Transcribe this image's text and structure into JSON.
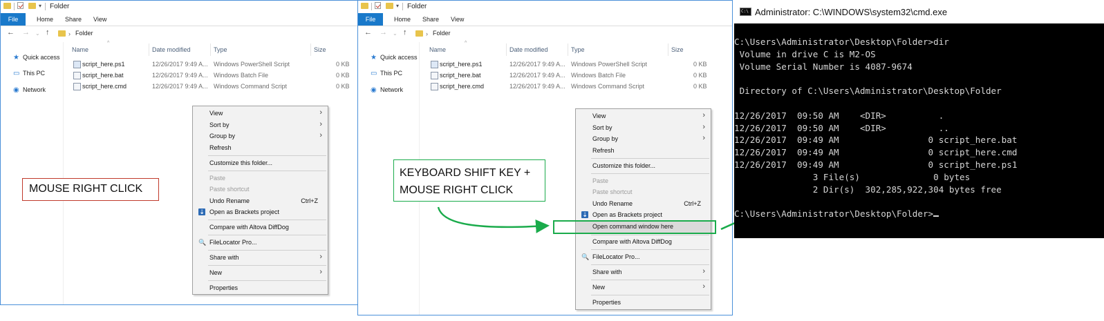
{
  "explorer": {
    "title": "Folder",
    "tabs": {
      "file": "File",
      "home": "Home",
      "share": "Share",
      "view": "View"
    },
    "address": "Folder",
    "nav": {
      "quick": "Quick access",
      "pc": "This PC",
      "network": "Network"
    },
    "columns": {
      "name": "Name",
      "date": "Date modified",
      "type": "Type",
      "size": "Size"
    },
    "files": [
      {
        "name": "script_here.ps1",
        "date": "12/26/2017 9:49 A...",
        "type": "Windows PowerShell Script",
        "size": "0 KB"
      },
      {
        "name": "script_here.bat",
        "date": "12/26/2017 9:49 A...",
        "type": "Windows Batch File",
        "size": "0 KB"
      },
      {
        "name": "script_here.cmd",
        "date": "12/26/2017 9:49 A...",
        "type": "Windows Command Script",
        "size": "0 KB"
      }
    ]
  },
  "menu1": {
    "view": "View",
    "sort": "Sort by",
    "group": "Group by",
    "refresh": "Refresh",
    "customize": "Customize this folder...",
    "paste": "Paste",
    "paste_shortcut": "Paste shortcut",
    "undo": "Undo Rename",
    "undo_shortcut": "Ctrl+Z",
    "brackets": "Open as Brackets project",
    "diffdog": "Compare with Altova DiffDog",
    "filelocator": "FileLocator Pro...",
    "share": "Share with",
    "new": "New",
    "properties": "Properties"
  },
  "menu2": {
    "view": "View",
    "sort": "Sort by",
    "group": "Group by",
    "refresh": "Refresh",
    "customize": "Customize this folder...",
    "paste": "Paste",
    "paste_shortcut": "Paste shortcut",
    "undo": "Undo Rename",
    "undo_shortcut": "Ctrl+Z",
    "brackets": "Open as Brackets project",
    "open_cmd": "Open command window here",
    "diffdog": "Compare with Altova DiffDog",
    "filelocator": "FileLocator Pro...",
    "share": "Share with",
    "new": "New",
    "properties": "Properties"
  },
  "annotations": {
    "mouse_right": "MOUSE RIGHT CLICK",
    "shift_line1": "KEYBOARD SHIFT KEY +",
    "shift_line2": "MOUSE RIGHT CLICK",
    "red": "#c0392b",
    "green": "#1aab4b"
  },
  "cmd": {
    "title": "Administrator: C:\\WINDOWS\\system32\\cmd.exe",
    "icon_text": "C:\\",
    "lines": [
      "C:\\Users\\Administrator\\Desktop\\Folder>dir",
      " Volume in drive C is M2-OS",
      " Volume Serial Number is 4087-9674",
      "",
      " Directory of C:\\Users\\Administrator\\Desktop\\Folder",
      "",
      "12/26/2017  09:50 AM    <DIR>          .",
      "12/26/2017  09:50 AM    <DIR>          ..",
      "12/26/2017  09:49 AM                 0 script_here.bat",
      "12/26/2017  09:49 AM                 0 script_here.cmd",
      "12/26/2017  09:49 AM                 0 script_here.ps1",
      "               3 File(s)              0 bytes",
      "               2 Dir(s)  302,285,922,304 bytes free",
      "",
      "C:\\Users\\Administrator\\Desktop\\Folder>"
    ]
  }
}
